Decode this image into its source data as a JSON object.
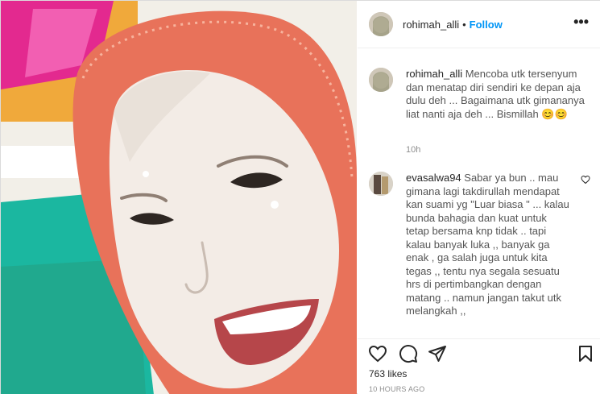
{
  "post": {
    "username": "rohimah_alli",
    "dot": "•",
    "follow_label": "Follow",
    "more_label": "•••",
    "photo_alt": ""
  },
  "caption": {
    "username": "rohimah_alli",
    "text": "Mencoba utk tersenyum dan menatap diri sendiri ke depan aja dulu deh ... Bagaimana utk gimananya liat nanti aja deh ... Bismillah 😊😊",
    "time": "10h"
  },
  "comments": [
    {
      "username": "evasalwa94",
      "text": "Sabar ya bun .. mau gimana lagi takdirullah mendapat kan suami yg \"Luar biasa \" ... kalau bunda bahagia dan kuat untuk tetap bersama knp tidak .. tapi kalau banyak luka ,, banyak ga enak , ga salah juga untuk kita tegas ,, tentu nya segala sesuatu hrs di pertimbangkan dengan matang .. namun jangan takut utk melangkah ,,"
    }
  ],
  "actions": {
    "like_icon": "heart-icon",
    "comment_icon": "comment-icon",
    "share_icon": "share-icon",
    "save_icon": "bookmark-icon"
  },
  "likes": "763 likes",
  "timeago": "10 HOURS AGO",
  "colors": {
    "follow_blue": "#0095f6",
    "text": "#262626",
    "muted": "#8e8e8e",
    "border": "#dbdbdb"
  }
}
